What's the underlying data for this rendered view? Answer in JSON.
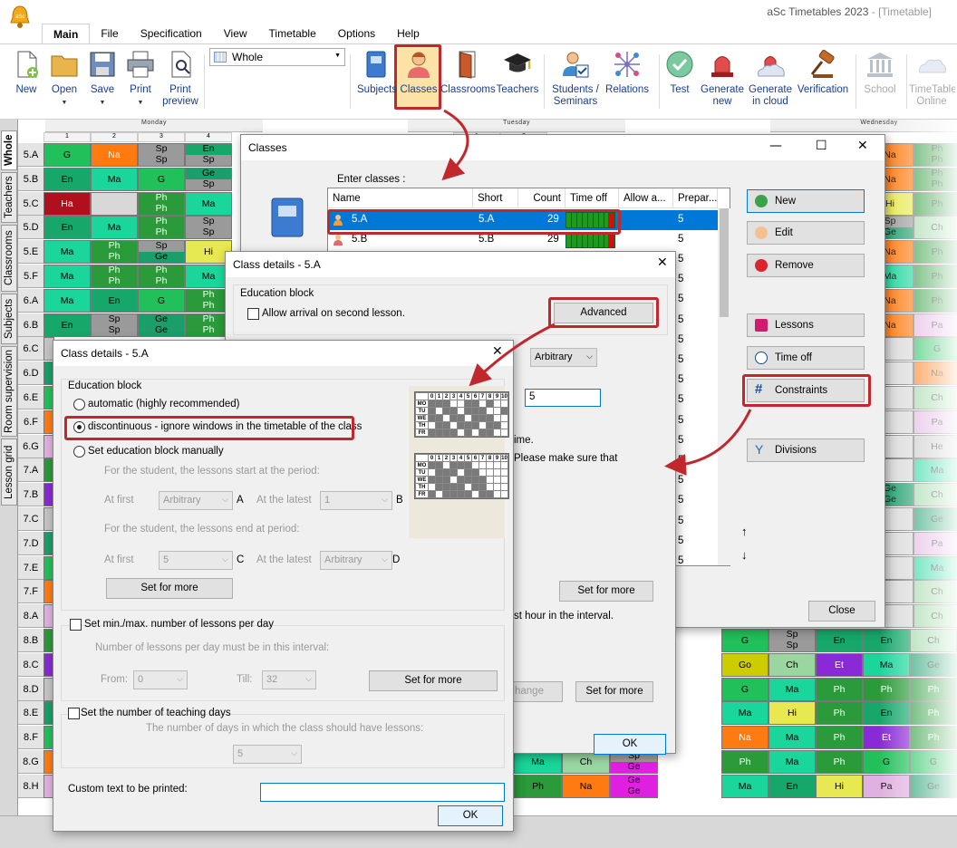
{
  "app": {
    "title": "aSc Timetables 2023",
    "title_suffix": "- [Timetable]",
    "menu": [
      "Main",
      "File",
      "Specification",
      "View",
      "Timetable",
      "Options",
      "Help"
    ]
  },
  "ribbon": {
    "view_select": "Whole",
    "buttons": [
      {
        "label": "New",
        "icon": "new-file-icon"
      },
      {
        "label": "Open",
        "icon": "folder-icon"
      },
      {
        "label": "Save",
        "icon": "disk-icon"
      },
      {
        "label": "Print",
        "icon": "printer-icon"
      },
      {
        "label": "Print preview",
        "icon": "print-preview-icon"
      },
      {
        "label": "Subjects",
        "icon": "book-icon"
      },
      {
        "label": "Classes",
        "icon": "student-icon"
      },
      {
        "label": "Classrooms",
        "icon": "door-icon"
      },
      {
        "label": "Teachers",
        "icon": "mortarboard-icon"
      },
      {
        "label": "Students / Seminars",
        "icon": "student-check-icon"
      },
      {
        "label": "Relations",
        "icon": "relations-icon"
      },
      {
        "label": "Test",
        "icon": "checkmark-icon"
      },
      {
        "label": "Generate new",
        "icon": "siren-icon"
      },
      {
        "label": "Generate in cloud",
        "icon": "cloud-siren-icon"
      },
      {
        "label": "Verification",
        "icon": "gavel-icon"
      },
      {
        "label": "School",
        "icon": "school-icon"
      },
      {
        "label": "TimeTable Online",
        "icon": "cloud-icon"
      }
    ]
  },
  "side_tabs": [
    "Whole",
    "Teachers",
    "Classrooms",
    "Subjects",
    "Room supervision",
    "Lesson grid"
  ],
  "grid": {
    "days": [
      "Monday",
      "Tuesday",
      "Wednesday"
    ],
    "periods": [
      "1",
      "2",
      "3",
      "4",
      "1",
      "2"
    ],
    "classes": [
      "5.A",
      "5.B",
      "5.C",
      "5.D",
      "5.E",
      "5.F",
      "6.A",
      "6.B",
      "6.C",
      "6.D",
      "6.E",
      "6.F",
      "6.G",
      "7.A",
      "7.B",
      "7.C",
      "7.D",
      "7.E",
      "7.F",
      "8.A",
      "8.B",
      "8.C",
      "8.D",
      "8.E",
      "8.F",
      "8.G",
      "8.H"
    ],
    "left_cells": [
      [
        "G",
        "Na",
        "Sp|Sp",
        "En|Sp"
      ],
      [
        "En",
        "Ma",
        "G",
        "Ge|Sp"
      ],
      [
        "Ha",
        "",
        "Ph|Ph",
        "Ma"
      ],
      [
        "En",
        "Ma",
        "Ph|Ph",
        "Sp|Sp"
      ],
      [
        "Ma",
        "Ph|Ph",
        "Sp|Ge",
        "Hi"
      ],
      [
        "Ma",
        "Ph|Ph",
        "Ph|Ph",
        "Ma"
      ],
      [
        "Ma",
        "En",
        "G",
        "Ph|Ph"
      ],
      [
        "En",
        "Sp|Sp",
        "Ge|Ge",
        "Ph|Ph"
      ]
    ],
    "bottom_cells": [
      [
        "Ma",
        "Ch",
        "Sp|Ge"
      ],
      [
        "Ph",
        "Na",
        "Ge|Ge"
      ]
    ],
    "right_cells": [
      [
        "Na",
        "Ph|Ph"
      ],
      [
        "Na",
        "Ph|Ph"
      ],
      [
        "Hi",
        "Ph"
      ],
      [
        "Sp|Ge",
        "Ch"
      ],
      [
        "Na",
        "Ph"
      ],
      [
        "Ma",
        "Ph"
      ],
      [
        "Na",
        "Ph"
      ],
      [
        "Na",
        "Pa"
      ],
      [
        "",
        "G"
      ],
      [
        "",
        "Na"
      ],
      [
        "",
        "Ch"
      ],
      [
        "",
        "Pa"
      ],
      [
        "",
        "He"
      ],
      [
        "",
        "Ma"
      ],
      [
        "Ge|Ge",
        "Ch"
      ],
      [
        "",
        "Ge"
      ],
      [
        "",
        "Pa"
      ],
      [
        "",
        "Ma"
      ],
      [
        "",
        "Ch"
      ],
      [
        "",
        "Ch"
      ]
    ],
    "lower_right_cells": [
      [
        "G",
        "Sp|Sp",
        "En",
        "En",
        "Ch"
      ],
      [
        "Go",
        "Ch",
        "Et",
        "Ma",
        "Ge"
      ],
      [
        "G",
        "Ma",
        "Ph",
        "Ph",
        "Ph"
      ],
      [
        "Ma",
        "Hi",
        "Ph",
        "En",
        "Ph"
      ],
      [
        "Na",
        "Ma",
        "Ph",
        "Et",
        "Ph"
      ],
      [
        "Ph",
        "Ma",
        "Ph",
        "G",
        "G"
      ],
      [
        "Ma",
        "En",
        "Hi",
        "Pa",
        "Ge"
      ]
    ]
  },
  "classes_dialog": {
    "title": "Classes",
    "enter_label": "Enter classes :",
    "columns": [
      "Name",
      "Short",
      "Count",
      "Time off",
      "Allow a...",
      "Prepar..."
    ],
    "rows": [
      {
        "name": "5.A",
        "short": "5.A",
        "count": "29",
        "prepar": "5"
      },
      {
        "name": "5.B",
        "short": "5.B",
        "count": "29",
        "prepar": "5"
      }
    ],
    "extra_prepar": [
      "5",
      "5",
      "5",
      "5",
      "5",
      "5",
      "5",
      "5",
      "5",
      "5",
      "5",
      "5",
      "5",
      "5",
      "5",
      "5"
    ],
    "buttons": {
      "new": "New",
      "edit": "Edit",
      "remove": "Remove",
      "lessons": "Lessons",
      "time_off": "Time off",
      "constraints": "Constraints",
      "divisions": "Divisions",
      "close": "Close"
    }
  },
  "details_back": {
    "title": "Class details - 5.A",
    "group": "Education block",
    "allow_arrival": "Allow arrival on second lesson.",
    "advanced": "Advanced",
    "combo": "Arbitrary",
    "input_value": "5",
    "text_time": "ime.",
    "text_please": "Please make sure that",
    "set_for_more": "Set for more",
    "text_hour": "st hour in the interval.",
    "change": "hange",
    "set_for_more2": "Set for more",
    "ok": "OK"
  },
  "details_front": {
    "title": "Class details - 5.A",
    "group": "Education block",
    "opt_auto": "automatic (highly recommended)",
    "opt_disc": "discontinuous - ignore windows in the timetable of the class",
    "opt_manual": "Set education block manually",
    "start_text": "For the student, the lessons start at the period:",
    "at_first": "At first",
    "at_latest": "At the latest",
    "start_first": "Arbitrary",
    "start_latest": "1",
    "letter_a": "A",
    "letter_b": "B",
    "end_text": "For the student, the lessons end at period:",
    "end_first": "5",
    "end_latest": "Arbitrary",
    "letter_c": "C",
    "letter_d": "D",
    "set_for_more": "Set for more",
    "minmax_label": "Set min./max. number of lessons per day",
    "minmax_text": "Number of lessons per day must be in this interval:",
    "from": "From:",
    "from_val": "0",
    "till": "Till:",
    "till_val": "32",
    "set_for_more2": "Set for more",
    "teaching_days_label": "Set the number of teaching days",
    "teaching_days_text": "The number of days in which the class should have lessons:",
    "teaching_days_val": "5",
    "custom_text": "Custom text to be printed:",
    "custom_value": "",
    "ok": "OK",
    "mini_days": [
      "MO",
      "TU",
      "WE",
      "TH",
      "FR"
    ],
    "mini_periods": [
      "0",
      "1",
      "2",
      "3",
      "4",
      "5",
      "6",
      "7",
      "8",
      "9",
      "10"
    ]
  },
  "colors": {
    "accent": "#0078d7",
    "highlight_red": "#c0282d",
    "selection": "#0078d7"
  }
}
